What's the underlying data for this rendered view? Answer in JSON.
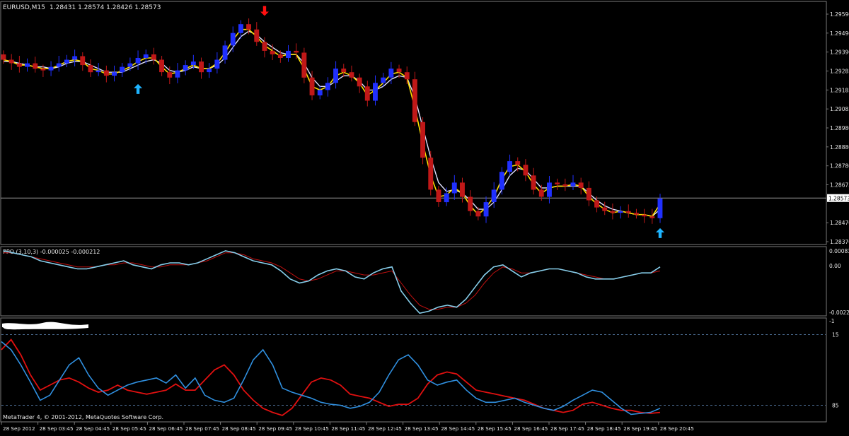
{
  "header": {
    "symbol_tf": "EURUSD,M15",
    "ohlc": "1.28431 1.28574 1.28426 1.28573"
  },
  "price_axis": {
    "labels": [
      "1.29590",
      "1.29490",
      "1.29390",
      "1.29285",
      "1.29185",
      "1.29085",
      "1.28980",
      "1.28880",
      "1.28780",
      "1.28675",
      "1.28573",
      "1.28470",
      "1.28370"
    ],
    "current": "1.28573"
  },
  "ppo": {
    "label": "PPO (3,10,3) -0.000025 -0.000212",
    "axis_labels": [
      "0.00083",
      "0.00",
      "-0.00229"
    ]
  },
  "stoch": {
    "axis_labels": [
      "15",
      "85"
    ]
  },
  "time_axis": {
    "labels": [
      "28 Sep 2012",
      "28 Sep 03:45",
      "28 Sep 04:45",
      "28 Sep 05:45",
      "28 Sep 06:45",
      "28 Sep 07:45",
      "28 Sep 08:45",
      "28 Sep 09:45",
      "28 Sep 10:45",
      "28 Sep 11:45",
      "28 Sep 12:45",
      "28 Sep 13:45",
      "28 Sep 14:45",
      "28 Sep 15:45",
      "28 Sep 16:45",
      "28 Sep 17:45",
      "28 Sep 18:45",
      "28 Sep 19:45",
      "28 Sep 20:45"
    ]
  },
  "copyright": "MetaTrader 4, © 2001-2012, MetaQuotes Software Corp.",
  "colors": {
    "bull": "#2030ff",
    "bear": "#c01818",
    "ma_fast": "#ffe000",
    "ma_slow": "#e0e0ff",
    "ppo_main": "#87ceeb",
    "ppo_signal": "#c01010",
    "stoch_main": "#3090e0",
    "stoch_signal": "#e01010",
    "arrow_up": "#1eb4ff",
    "arrow_down": "#ff1010"
  },
  "chart_data": [
    {
      "type": "candlestick",
      "title": "EURUSD,M15",
      "ylim": [
        1.2832,
        1.2963
      ],
      "current_price": 1.28573,
      "close": [
        1.2935,
        1.2933,
        1.2931,
        1.2933,
        1.293,
        1.2929,
        1.2931,
        1.2933,
        1.2935,
        1.2937,
        1.2932,
        1.2928,
        1.2929,
        1.2926,
        1.2928,
        1.2931,
        1.2933,
        1.2936,
        1.2938,
        1.2935,
        1.2928,
        1.2925,
        1.2929,
        1.2932,
        1.2934,
        1.2928,
        1.293,
        1.2935,
        1.2943,
        1.295,
        1.2955,
        1.2952,
        1.2945,
        1.294,
        1.2938,
        1.2936,
        1.294,
        1.2939,
        1.2925,
        1.2915,
        1.2918,
        1.2922,
        1.293,
        1.2928,
        1.2925,
        1.292,
        1.2912,
        1.2922,
        1.2925,
        1.293,
        1.2928,
        1.2924,
        1.29,
        1.288,
        1.2862,
        1.2855,
        1.286,
        1.2866,
        1.2858,
        1.285,
        1.2847,
        1.2855,
        1.2862,
        1.2872,
        1.2878,
        1.2876,
        1.287,
        1.2862,
        1.2858,
        1.2866,
        1.2865,
        1.2864,
        1.2866,
        1.2863,
        1.2856,
        1.2852,
        1.285,
        1.2849,
        1.285,
        1.2849,
        1.2848,
        1.2847,
        1.2846,
        1.2857
      ],
      "ma_fast": [
        1.2935,
        1.2934,
        1.2932,
        1.2932,
        1.2931,
        1.293,
        1.293,
        1.2932,
        1.2934,
        1.2935,
        1.2934,
        1.293,
        1.2929,
        1.2927,
        1.2927,
        1.2929,
        1.2931,
        1.2934,
        1.2936,
        1.2936,
        1.2931,
        1.2927,
        1.2928,
        1.293,
        1.2932,
        1.293,
        1.293,
        1.2933,
        1.2939,
        1.2946,
        1.2952,
        1.2952,
        1.2948,
        1.2943,
        1.294,
        1.2937,
        1.2938,
        1.2938,
        1.293,
        1.292,
        1.2918,
        1.292,
        1.2926,
        1.2928,
        1.2926,
        1.2922,
        1.2915,
        1.2918,
        1.2922,
        1.2927,
        1.2928,
        1.2925,
        1.2908,
        1.2888,
        1.287,
        1.2858,
        1.2859,
        1.2863,
        1.286,
        1.2853,
        1.2848,
        1.2852,
        1.2858,
        1.2868,
        1.2875,
        1.2876,
        1.2872,
        1.2865,
        1.286,
        1.2863,
        1.2864,
        1.2864,
        1.2865,
        1.2864,
        1.2858,
        1.2854,
        1.2851,
        1.2849,
        1.285,
        1.2849,
        1.2848,
        1.2848,
        1.2847,
        1.2854
      ],
      "ma_slow": [
        1.2934,
        1.2934,
        1.2933,
        1.2932,
        1.2931,
        1.2931,
        1.293,
        1.2931,
        1.2933,
        1.2934,
        1.2934,
        1.2932,
        1.293,
        1.2928,
        1.2928,
        1.2928,
        1.293,
        1.2932,
        1.2934,
        1.2935,
        1.2933,
        1.2929,
        1.2928,
        1.2929,
        1.2931,
        1.293,
        1.293,
        1.2932,
        1.2936,
        1.2942,
        1.2948,
        1.2951,
        1.2949,
        1.2945,
        1.2942,
        1.2939,
        1.2938,
        1.2938,
        1.2933,
        1.2925,
        1.292,
        1.292,
        1.2923,
        1.2926,
        1.2926,
        1.2923,
        1.2918,
        1.2918,
        1.292,
        1.2924,
        1.2926,
        1.2925,
        1.2914,
        1.2897,
        1.288,
        1.2866,
        1.2861,
        1.2862,
        1.286,
        1.2856,
        1.2851,
        1.2851,
        1.2855,
        1.2862,
        1.287,
        1.2874,
        1.2873,
        1.2868,
        1.2863,
        1.2863,
        1.2864,
        1.2864,
        1.2864,
        1.2864,
        1.286,
        1.2856,
        1.2853,
        1.2851,
        1.285,
        1.2849,
        1.2848,
        1.2848,
        1.2847,
        1.2851
      ],
      "arrows": [
        {
          "index": 17,
          "dir": "up",
          "price": 1.2919
        },
        {
          "index": 33,
          "dir": "down",
          "price": 1.2962
        },
        {
          "index": 83,
          "dir": "up",
          "price": 1.2838
        }
      ]
    },
    {
      "type": "line",
      "title": "PPO (3,10,3) -0.000025 -0.000212",
      "ylim": [
        -0.00229,
        0.00083
      ],
      "series": [
        {
          "values": [
            0.0008,
            0.0007,
            0.0006,
            0.0005,
            0.0003,
            0.0002,
            0.0001,
            0.0,
            -0.0001,
            -0.0001,
            0.0,
            0.0001,
            0.0002,
            0.0003,
            0.0001,
            0.0,
            -0.0001,
            0.0001,
            0.0002,
            0.0002,
            0.0001,
            0.0002,
            0.0004,
            0.0006,
            0.0008,
            0.0007,
            0.0005,
            0.0003,
            0.0002,
            0.0001,
            -0.0002,
            -0.0006,
            -0.0008,
            -0.0007,
            -0.0004,
            -0.0002,
            -0.0001,
            -0.0002,
            -0.0005,
            -0.0006,
            -0.0003,
            -0.0001,
            0.0,
            -0.0012,
            -0.0018,
            -0.0023,
            -0.0022,
            -0.002,
            -0.0019,
            -0.002,
            -0.0016,
            -0.001,
            -0.0004,
            0.0,
            0.0001,
            -0.0002,
            -0.0005,
            -0.0003,
            -0.0002,
            -0.0001,
            -0.0001,
            -0.0002,
            -0.0003,
            -0.0005,
            -0.0006,
            -0.0006,
            -0.0006,
            -0.0005,
            -0.0004,
            -0.0003,
            -0.0003,
            0.0
          ]
        },
        {
          "values": [
            0.0007,
            0.0007,
            0.0006,
            0.0005,
            0.0004,
            0.0003,
            0.0002,
            0.0001,
            0.0,
            0.0,
            0.0,
            0.0001,
            0.0001,
            0.0002,
            0.0002,
            0.0001,
            0.0,
            0.0,
            0.0001,
            0.0001,
            0.0001,
            0.0002,
            0.0003,
            0.0005,
            0.0007,
            0.0007,
            0.0006,
            0.0004,
            0.0003,
            0.0002,
            0.0,
            -0.0003,
            -0.0006,
            -0.0007,
            -0.0006,
            -0.0004,
            -0.0002,
            -0.0002,
            -0.0003,
            -0.0004,
            -0.0004,
            -0.0003,
            -0.0002,
            -0.0008,
            -0.0014,
            -0.0019,
            -0.0021,
            -0.0021,
            -0.002,
            -0.002,
            -0.0018,
            -0.0014,
            -0.0008,
            -0.0003,
            0.0,
            -0.0001,
            -0.0003,
            -0.0003,
            -0.0002,
            -0.0001,
            -0.0001,
            -0.0002,
            -0.0003,
            -0.0004,
            -0.0005,
            -0.0006,
            -0.0006,
            -0.0005,
            -0.0004,
            -0.0003,
            -0.0003,
            -0.0002
          ]
        }
      ]
    },
    {
      "type": "line",
      "ylim": [
        0,
        100
      ],
      "levels": [
        15,
        85
      ],
      "series": [
        {
          "values": [
            22,
            30,
            45,
            62,
            80,
            75,
            60,
            45,
            38,
            55,
            68,
            75,
            70,
            65,
            62,
            60,
            58,
            63,
            55,
            68,
            58,
            75,
            80,
            82,
            78,
            60,
            40,
            30,
            45,
            68,
            72,
            75,
            78,
            82,
            84,
            85,
            88,
            86,
            82,
            72,
            55,
            40,
            35,
            45,
            60,
            65,
            62,
            60,
            70,
            78,
            82,
            82,
            80,
            78,
            82,
            85,
            88,
            90,
            86,
            80,
            75,
            70,
            72,
            80,
            88,
            94,
            93,
            92,
            88
          ]
        },
        {
          "values": [
            30,
            20,
            35,
            55,
            70,
            65,
            60,
            58,
            62,
            68,
            72,
            70,
            65,
            70,
            72,
            74,
            72,
            70,
            64,
            70,
            70,
            60,
            50,
            45,
            55,
            70,
            80,
            88,
            92,
            95,
            88,
            75,
            62,
            58,
            60,
            65,
            74,
            76,
            78,
            82,
            86,
            84,
            84,
            78,
            64,
            55,
            52,
            54,
            62,
            70,
            72,
            74,
            76,
            78,
            80,
            84,
            88,
            90,
            92,
            90,
            84,
            82,
            85,
            88,
            90,
            90,
            92,
            93,
            92
          ]
        }
      ]
    }
  ]
}
